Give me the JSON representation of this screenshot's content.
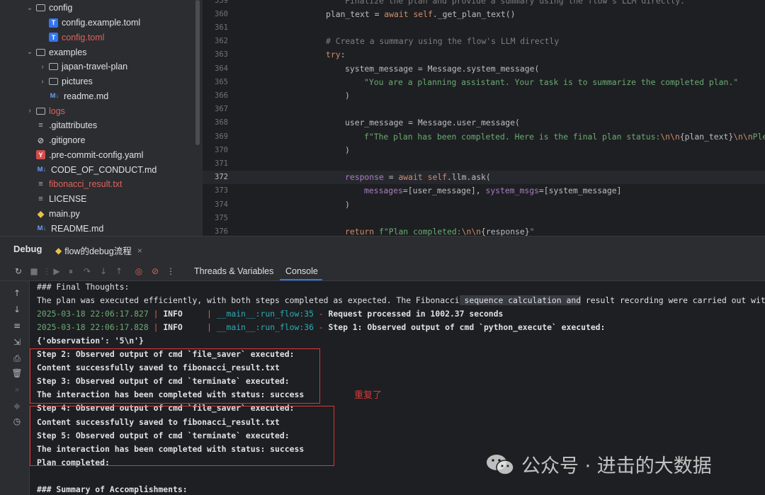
{
  "project_tree": {
    "items": [
      {
        "label": "config",
        "kind": "folder",
        "expanded": true,
        "depth": 1
      },
      {
        "label": "config.example.toml",
        "kind": "toml",
        "depth": 2
      },
      {
        "label": "config.toml",
        "kind": "toml",
        "depth": 2,
        "modified": true
      },
      {
        "label": "examples",
        "kind": "folder",
        "expanded": true,
        "depth": 1
      },
      {
        "label": "japan-travel-plan",
        "kind": "folder",
        "expanded": false,
        "depth": 2
      },
      {
        "label": "pictures",
        "kind": "folder",
        "expanded": false,
        "depth": 2
      },
      {
        "label": "readme.md",
        "kind": "md",
        "depth": 2
      },
      {
        "label": "logs",
        "kind": "folder",
        "expanded": false,
        "depth": 1,
        "modified": true
      },
      {
        "label": ".gitattributes",
        "kind": "file",
        "depth": 1
      },
      {
        "label": ".gitignore",
        "kind": "ignore",
        "depth": 1
      },
      {
        "label": ".pre-commit-config.yaml",
        "kind": "yaml",
        "depth": 1
      },
      {
        "label": "CODE_OF_CONDUCT.md",
        "kind": "md",
        "depth": 1
      },
      {
        "label": "fibonacci_result.txt",
        "kind": "file",
        "depth": 1,
        "modified": true
      },
      {
        "label": "LICENSE",
        "kind": "file",
        "depth": 1
      },
      {
        "label": "main.py",
        "kind": "py",
        "depth": 1
      },
      {
        "label": "README.md",
        "kind": "md",
        "depth": 1
      }
    ]
  },
  "editor": {
    "current_line": "372",
    "lines": [
      {
        "num": "359",
        "indent": 2,
        "spans": [
          {
            "c": "cm",
            "t": "Finalize the plan and provide a summary using the flow's LLM directly."
          }
        ]
      },
      {
        "num": "360",
        "indent": 1,
        "spans": [
          {
            "c": "",
            "t": "plan_text = "
          },
          {
            "c": "kw",
            "t": "await "
          },
          {
            "c": "kw",
            "t": "self"
          },
          {
            "c": "",
            "t": "._get_plan_text()"
          }
        ]
      },
      {
        "num": "361",
        "indent": 1,
        "spans": []
      },
      {
        "num": "362",
        "indent": 1,
        "spans": [
          {
            "c": "cm",
            "t": "# Create a summary using the flow's LLM directly"
          }
        ]
      },
      {
        "num": "363",
        "indent": 1,
        "spans": [
          {
            "c": "kw",
            "t": "try"
          },
          {
            "c": "",
            "t": ":"
          }
        ]
      },
      {
        "num": "364",
        "indent": 2,
        "spans": [
          {
            "c": "",
            "t": "system_message = Message.system_message("
          }
        ]
      },
      {
        "num": "365",
        "indent": 3,
        "spans": [
          {
            "c": "str",
            "t": "\"You are a planning assistant. Your task is to summarize the completed plan.\""
          }
        ]
      },
      {
        "num": "366",
        "indent": 2,
        "spans": [
          {
            "c": "",
            "t": ")"
          }
        ]
      },
      {
        "num": "367",
        "indent": 1,
        "spans": []
      },
      {
        "num": "368",
        "indent": 2,
        "spans": [
          {
            "c": "",
            "t": "user_message = Message.user_message("
          }
        ]
      },
      {
        "num": "369",
        "indent": 3,
        "spans": [
          {
            "c": "str",
            "t": "f\"The plan has been completed. Here is the final plan status:"
          },
          {
            "c": "esc",
            "t": "\\n\\n"
          },
          {
            "c": "",
            "t": "{plan_text}"
          },
          {
            "c": "esc",
            "t": "\\n\\n"
          },
          {
            "c": "str",
            "t": "Please pr"
          }
        ]
      },
      {
        "num": "370",
        "indent": 2,
        "spans": [
          {
            "c": "",
            "t": ")"
          }
        ]
      },
      {
        "num": "371",
        "indent": 1,
        "spans": []
      },
      {
        "num": "372",
        "indent": 2,
        "spans": [
          {
            "c": "par",
            "t": "response"
          },
          {
            "c": "",
            "t": " = "
          },
          {
            "c": "kw",
            "t": "await "
          },
          {
            "c": "kw",
            "t": "self"
          },
          {
            "c": "",
            "t": ".llm.ask("
          }
        ]
      },
      {
        "num": "373",
        "indent": 3,
        "spans": [
          {
            "c": "par",
            "t": "messages"
          },
          {
            "c": "",
            "t": "=[user_message], "
          },
          {
            "c": "par",
            "t": "system_msgs"
          },
          {
            "c": "",
            "t": "=[system_message]"
          }
        ]
      },
      {
        "num": "374",
        "indent": 2,
        "spans": [
          {
            "c": "",
            "t": ")"
          }
        ]
      },
      {
        "num": "375",
        "indent": 1,
        "spans": []
      },
      {
        "num": "376",
        "indent": 2,
        "spans": [
          {
            "c": "kw",
            "t": "return "
          },
          {
            "c": "str",
            "t": "f\"Plan completed:"
          },
          {
            "c": "esc",
            "t": "\\n\\n"
          },
          {
            "c": "",
            "t": "{response}"
          },
          {
            "c": "str",
            "t": "\""
          }
        ]
      }
    ]
  },
  "debug": {
    "title": "Debug",
    "session_tab": "flow的debug流程",
    "close_glyph": "×",
    "tabs": {
      "threads": "Threads & Variables",
      "console": "Console"
    }
  },
  "console": {
    "lines": [
      {
        "type": "text",
        "t": "### Final Thoughts:"
      },
      {
        "type": "text_sel",
        "pre": "The plan was executed efficiently, with both steps completed as expected. The Fibonacci",
        "sel": " sequence calculation and",
        "post": " result recording were carried out witho"
      },
      {
        "type": "log",
        "ts": "2025-03-18 22:06:17.827",
        "level": "INFO    ",
        "mod": "__main__:run_flow:35",
        "msg": "Request processed in 1002.37 seconds"
      },
      {
        "type": "log",
        "ts": "2025-03-18 22:06:17.828",
        "level": "INFO    ",
        "mod": "__main__:run_flow:36",
        "msg": "Step 1: Observed output of cmd `python_execute` executed:"
      },
      {
        "type": "bold",
        "t": "{'observation': '5\\n'}"
      },
      {
        "type": "bold",
        "t": "Step 2: Observed output of cmd `file_saver` executed:"
      },
      {
        "type": "bold",
        "t": "Content successfully saved to fibonacci_result.txt"
      },
      {
        "type": "bold",
        "t": "Step 3: Observed output of cmd `terminate` executed:"
      },
      {
        "type": "bold",
        "t": "The interaction has been completed with status: success"
      },
      {
        "type": "bold",
        "t": "Step 4: Observed output of cmd `file_saver` executed:"
      },
      {
        "type": "bold",
        "t": "Content successfully saved to fibonacci_result.txt"
      },
      {
        "type": "bold",
        "t": "Step 5: Observed output of cmd `terminate` executed:"
      },
      {
        "type": "bold",
        "t": "The interaction has been completed with status: success"
      },
      {
        "type": "bold",
        "t": "Plan completed:"
      },
      {
        "type": "text",
        "t": ""
      },
      {
        "type": "bold",
        "t": "### Summary of Accomplishments:"
      }
    ],
    "annotation": "重复了"
  },
  "watermark": {
    "text": "公众号 · 进击的大数据"
  },
  "colors": {
    "accent": "#3574f0",
    "annotation_red": "#d9383a"
  }
}
